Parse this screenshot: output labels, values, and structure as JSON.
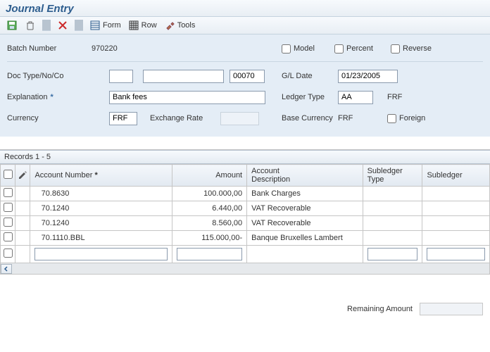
{
  "title": "Journal Entry",
  "toolbar": {
    "form_label": "Form",
    "row_label": "Row",
    "tools_label": "Tools"
  },
  "fields": {
    "batch_number_label": "Batch Number",
    "batch_number": "970220",
    "doc_type_label": "Doc Type/No/Co",
    "doc_type": "",
    "doc_no": "",
    "doc_co": "00070",
    "explanation_label": "Explanation",
    "explanation": "Bank fees",
    "currency_label": "Currency",
    "currency": "FRF",
    "exchange_label": "Exchange Rate",
    "exchange": "",
    "gl_date_label": "G/L Date",
    "gl_date": "01/23/2005",
    "ledger_type_label": "Ledger Type",
    "ledger_type": "AA",
    "ledger_type_extra": "FRF",
    "base_currency_label": "Base Currency",
    "base_currency": "FRF",
    "model_label": "Model",
    "percent_label": "Percent",
    "reverse_label": "Reverse",
    "foreign_label": "Foreign"
  },
  "grid": {
    "records_label": "Records 1 - 5",
    "headers": {
      "account_number": "Account Number",
      "amount": "Amount",
      "account_desc": "Account\nDescription",
      "subledger_type": "Subledger\nType",
      "subledger": "Subledger"
    },
    "rows": [
      {
        "acct": "70.8630",
        "amt": "100.000,00",
        "desc": "Bank Charges"
      },
      {
        "acct": "70.1240",
        "amt": "6.440,00",
        "desc": "VAT Recoverable"
      },
      {
        "acct": "70.1240",
        "amt": "8.560,00",
        "desc": "VAT Recoverable"
      },
      {
        "acct": "70.1110.BBL",
        "amt": "115.000,00-",
        "desc": "Banque Bruxelles Lambert"
      }
    ]
  },
  "footer": {
    "remaining_label": "Remaining Amount"
  }
}
